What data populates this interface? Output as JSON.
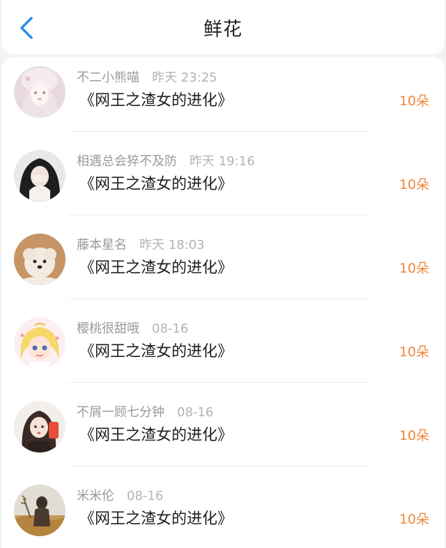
{
  "header": {
    "title": "鲜花"
  },
  "items": [
    {
      "name": "不二小熊喵",
      "time": "昨天 23:25",
      "book": "《网王之渣女的进化》",
      "count": "10朵"
    },
    {
      "name": "相遇总会猝不及防",
      "time": "昨天 19:16",
      "book": "《网王之渣女的进化》",
      "count": "10朵"
    },
    {
      "name": "藤本星名",
      "time": "昨天 18:03",
      "book": "《网王之渣女的进化》",
      "count": "10朵"
    },
    {
      "name": "樱桃很甜哦",
      "time": "08-16",
      "book": "《网王之渣女的进化》",
      "count": "10朵"
    },
    {
      "name": "不屑一顾七分钟",
      "time": "08-16",
      "book": "《网王之渣女的进化》",
      "count": "10朵"
    },
    {
      "name": "米米伦",
      "time": "08-16",
      "book": "《网王之渣女的进化》",
      "count": "10朵"
    }
  ],
  "colors": {
    "accent_back": "#2f8fe8",
    "flower_count": "#f0873a"
  }
}
